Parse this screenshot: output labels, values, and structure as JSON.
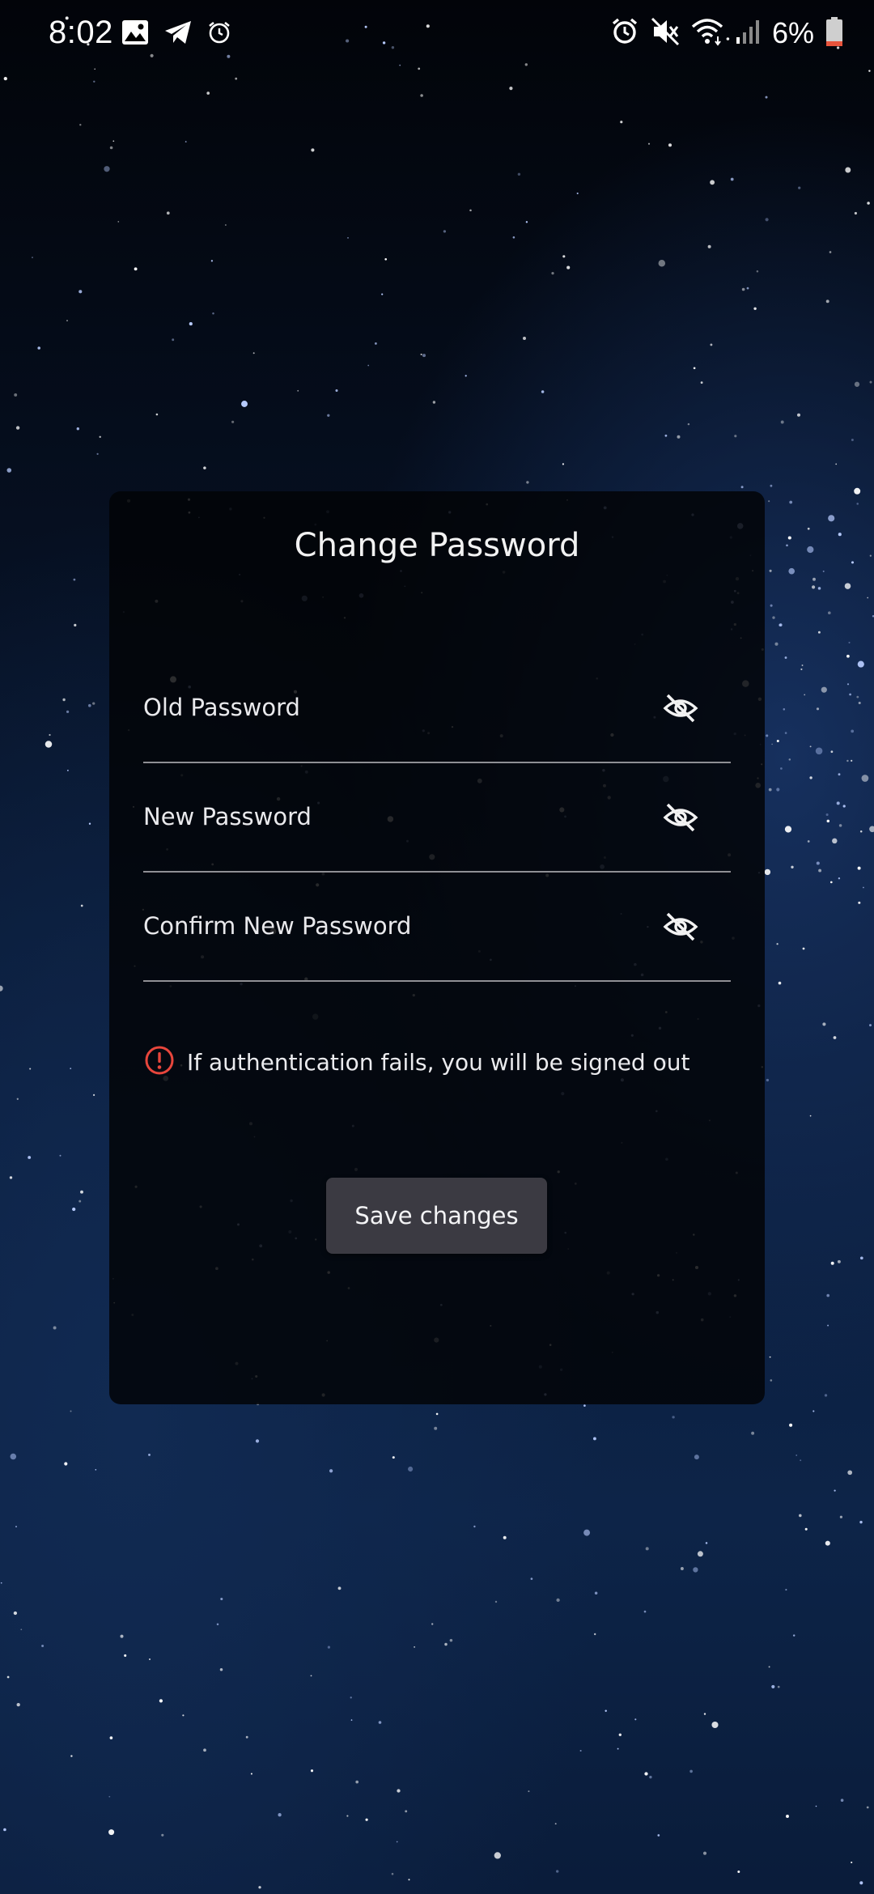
{
  "status_bar": {
    "time": "8:02",
    "left_icons": [
      "gallery-icon",
      "telegram-icon",
      "alarm-icon"
    ],
    "right_icons": [
      "alarm-icon",
      "mute-icon",
      "wifi-icon",
      "signal-icon",
      "battery-icon"
    ],
    "battery_percent": "6%",
    "battery_level": 0.06
  },
  "dialog": {
    "title": "Change Password",
    "fields": [
      {
        "label": "Old Password",
        "value": ""
      },
      {
        "label": "New Password",
        "value": ""
      },
      {
        "label": "Confirm New Password",
        "value": ""
      }
    ],
    "warning": "If authentication fails, you will be signed out",
    "save_label": "Save changes"
  },
  "colors": {
    "card_background": "#030409",
    "button_background": "#3b3a42",
    "warning_icon": "#e8463c",
    "divider": "#8f8f94",
    "battery_low": "#e8543c"
  }
}
